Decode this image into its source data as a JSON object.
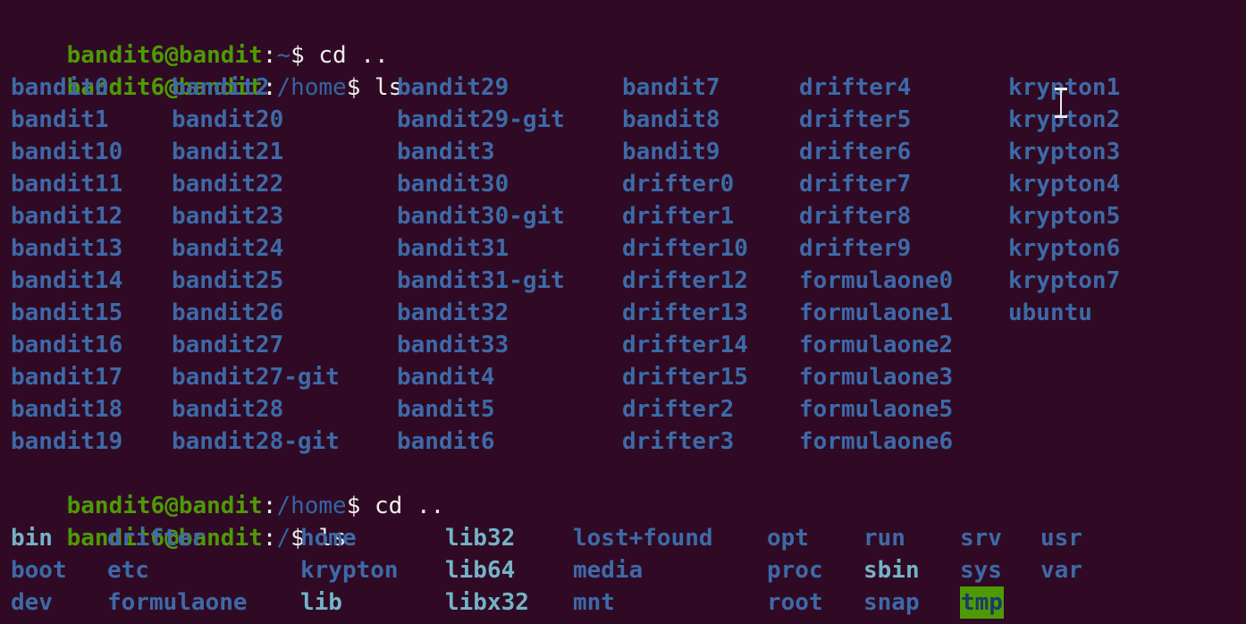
{
  "prompt": {
    "user": "bandit6@bandit",
    "colon": ":",
    "dollar": "$ "
  },
  "lines": [
    {
      "path": "~",
      "cmd": "cd .."
    },
    {
      "path": "/home",
      "cmd": "ls"
    },
    {
      "path": "/home",
      "cmd": "cd .."
    },
    {
      "path": "/",
      "cmd": "ls"
    }
  ],
  "home_listing": [
    [
      "bandit0",
      "bandit2",
      "bandit29",
      "bandit7",
      "drifter4",
      "krypton1"
    ],
    [
      "bandit1",
      "bandit20",
      "bandit29-git",
      "bandit8",
      "drifter5",
      "krypton2"
    ],
    [
      "bandit10",
      "bandit21",
      "bandit3",
      "bandit9",
      "drifter6",
      "krypton3"
    ],
    [
      "bandit11",
      "bandit22",
      "bandit30",
      "drifter0",
      "drifter7",
      "krypton4"
    ],
    [
      "bandit12",
      "bandit23",
      "bandit30-git",
      "drifter1",
      "drifter8",
      "krypton5"
    ],
    [
      "bandit13",
      "bandit24",
      "bandit31",
      "drifter10",
      "drifter9",
      "krypton6"
    ],
    [
      "bandit14",
      "bandit25",
      "bandit31-git",
      "drifter12",
      "formulaone0",
      "krypton7"
    ],
    [
      "bandit15",
      "bandit26",
      "bandit32",
      "drifter13",
      "formulaone1",
      "ubuntu"
    ],
    [
      "bandit16",
      "bandit27",
      "bandit33",
      "drifter14",
      "formulaone2",
      ""
    ],
    [
      "bandit17",
      "bandit27-git",
      "bandit4",
      "drifter15",
      "formulaone3",
      ""
    ],
    [
      "bandit18",
      "bandit28",
      "bandit5",
      "drifter2",
      "formulaone5",
      ""
    ],
    [
      "bandit19",
      "bandit28-git",
      "bandit6",
      "drifter3",
      "formulaone6",
      ""
    ]
  ],
  "root_listing": [
    [
      {
        "name": "bin",
        "style": "link"
      },
      {
        "name": "drifter",
        "style": "dir"
      },
      {
        "name": "home",
        "style": "dir"
      },
      {
        "name": "lib32",
        "style": "link"
      },
      {
        "name": "lost+found",
        "style": "dir"
      },
      {
        "name": "opt",
        "style": "dir"
      },
      {
        "name": "run",
        "style": "dir"
      },
      {
        "name": "srv",
        "style": "dir"
      },
      {
        "name": "usr",
        "style": "dir"
      }
    ],
    [
      {
        "name": "boot",
        "style": "dir"
      },
      {
        "name": "etc",
        "style": "dir"
      },
      {
        "name": "krypton",
        "style": "dir"
      },
      {
        "name": "lib64",
        "style": "link"
      },
      {
        "name": "media",
        "style": "dir"
      },
      {
        "name": "proc",
        "style": "dir"
      },
      {
        "name": "sbin",
        "style": "link"
      },
      {
        "name": "sys",
        "style": "dir"
      },
      {
        "name": "var",
        "style": "dir"
      }
    ],
    [
      {
        "name": "dev",
        "style": "dir"
      },
      {
        "name": "formulaone",
        "style": "dir"
      },
      {
        "name": "lib",
        "style": "link"
      },
      {
        "name": "libx32",
        "style": "link"
      },
      {
        "name": "mnt",
        "style": "dir"
      },
      {
        "name": "root",
        "style": "dir"
      },
      {
        "name": "snap",
        "style": "dir"
      },
      {
        "name": "tmp",
        "style": "hl"
      },
      {
        "name": "",
        "style": "dir"
      }
    ]
  ],
  "colors": {
    "background": "#300a24",
    "prompt_user": "#4e9a06",
    "prompt_path": "#3465a4",
    "directory": "#3d6aa8",
    "highlight_bg": "#4e9a06"
  },
  "icons": {
    "text_cursor": "text-cursor-icon"
  }
}
